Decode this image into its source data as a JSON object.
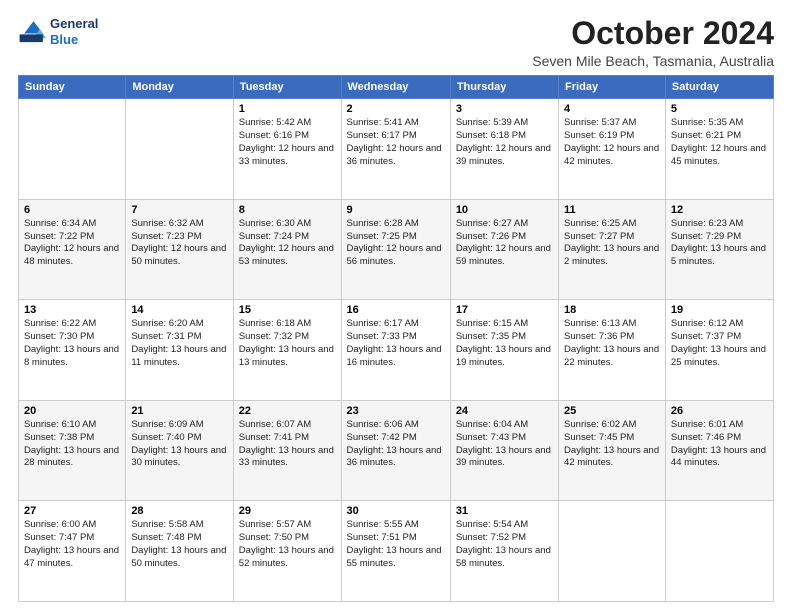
{
  "logo": {
    "line1": "General",
    "line2": "Blue"
  },
  "header": {
    "title": "October 2024",
    "subtitle": "Seven Mile Beach, Tasmania, Australia"
  },
  "weekdays": [
    "Sunday",
    "Monday",
    "Tuesday",
    "Wednesday",
    "Thursday",
    "Friday",
    "Saturday"
  ],
  "weeks": [
    [
      {
        "day": "",
        "detail": ""
      },
      {
        "day": "",
        "detail": ""
      },
      {
        "day": "1",
        "detail": "Sunrise: 5:42 AM\nSunset: 6:16 PM\nDaylight: 12 hours and 33 minutes."
      },
      {
        "day": "2",
        "detail": "Sunrise: 5:41 AM\nSunset: 6:17 PM\nDaylight: 12 hours and 36 minutes."
      },
      {
        "day": "3",
        "detail": "Sunrise: 5:39 AM\nSunset: 6:18 PM\nDaylight: 12 hours and 39 minutes."
      },
      {
        "day": "4",
        "detail": "Sunrise: 5:37 AM\nSunset: 6:19 PM\nDaylight: 12 hours and 42 minutes."
      },
      {
        "day": "5",
        "detail": "Sunrise: 5:35 AM\nSunset: 6:21 PM\nDaylight: 12 hours and 45 minutes."
      }
    ],
    [
      {
        "day": "6",
        "detail": "Sunrise: 6:34 AM\nSunset: 7:22 PM\nDaylight: 12 hours and 48 minutes."
      },
      {
        "day": "7",
        "detail": "Sunrise: 6:32 AM\nSunset: 7:23 PM\nDaylight: 12 hours and 50 minutes."
      },
      {
        "day": "8",
        "detail": "Sunrise: 6:30 AM\nSunset: 7:24 PM\nDaylight: 12 hours and 53 minutes."
      },
      {
        "day": "9",
        "detail": "Sunrise: 6:28 AM\nSunset: 7:25 PM\nDaylight: 12 hours and 56 minutes."
      },
      {
        "day": "10",
        "detail": "Sunrise: 6:27 AM\nSunset: 7:26 PM\nDaylight: 12 hours and 59 minutes."
      },
      {
        "day": "11",
        "detail": "Sunrise: 6:25 AM\nSunset: 7:27 PM\nDaylight: 13 hours and 2 minutes."
      },
      {
        "day": "12",
        "detail": "Sunrise: 6:23 AM\nSunset: 7:29 PM\nDaylight: 13 hours and 5 minutes."
      }
    ],
    [
      {
        "day": "13",
        "detail": "Sunrise: 6:22 AM\nSunset: 7:30 PM\nDaylight: 13 hours and 8 minutes."
      },
      {
        "day": "14",
        "detail": "Sunrise: 6:20 AM\nSunset: 7:31 PM\nDaylight: 13 hours and 11 minutes."
      },
      {
        "day": "15",
        "detail": "Sunrise: 6:18 AM\nSunset: 7:32 PM\nDaylight: 13 hours and 13 minutes."
      },
      {
        "day": "16",
        "detail": "Sunrise: 6:17 AM\nSunset: 7:33 PM\nDaylight: 13 hours and 16 minutes."
      },
      {
        "day": "17",
        "detail": "Sunrise: 6:15 AM\nSunset: 7:35 PM\nDaylight: 13 hours and 19 minutes."
      },
      {
        "day": "18",
        "detail": "Sunrise: 6:13 AM\nSunset: 7:36 PM\nDaylight: 13 hours and 22 minutes."
      },
      {
        "day": "19",
        "detail": "Sunrise: 6:12 AM\nSunset: 7:37 PM\nDaylight: 13 hours and 25 minutes."
      }
    ],
    [
      {
        "day": "20",
        "detail": "Sunrise: 6:10 AM\nSunset: 7:38 PM\nDaylight: 13 hours and 28 minutes."
      },
      {
        "day": "21",
        "detail": "Sunrise: 6:09 AM\nSunset: 7:40 PM\nDaylight: 13 hours and 30 minutes."
      },
      {
        "day": "22",
        "detail": "Sunrise: 6:07 AM\nSunset: 7:41 PM\nDaylight: 13 hours and 33 minutes."
      },
      {
        "day": "23",
        "detail": "Sunrise: 6:06 AM\nSunset: 7:42 PM\nDaylight: 13 hours and 36 minutes."
      },
      {
        "day": "24",
        "detail": "Sunrise: 6:04 AM\nSunset: 7:43 PM\nDaylight: 13 hours and 39 minutes."
      },
      {
        "day": "25",
        "detail": "Sunrise: 6:02 AM\nSunset: 7:45 PM\nDaylight: 13 hours and 42 minutes."
      },
      {
        "day": "26",
        "detail": "Sunrise: 6:01 AM\nSunset: 7:46 PM\nDaylight: 13 hours and 44 minutes."
      }
    ],
    [
      {
        "day": "27",
        "detail": "Sunrise: 6:00 AM\nSunset: 7:47 PM\nDaylight: 13 hours and 47 minutes."
      },
      {
        "day": "28",
        "detail": "Sunrise: 5:58 AM\nSunset: 7:48 PM\nDaylight: 13 hours and 50 minutes."
      },
      {
        "day": "29",
        "detail": "Sunrise: 5:57 AM\nSunset: 7:50 PM\nDaylight: 13 hours and 52 minutes."
      },
      {
        "day": "30",
        "detail": "Sunrise: 5:55 AM\nSunset: 7:51 PM\nDaylight: 13 hours and 55 minutes."
      },
      {
        "day": "31",
        "detail": "Sunrise: 5:54 AM\nSunset: 7:52 PM\nDaylight: 13 hours and 58 minutes."
      },
      {
        "day": "",
        "detail": ""
      },
      {
        "day": "",
        "detail": ""
      }
    ]
  ]
}
